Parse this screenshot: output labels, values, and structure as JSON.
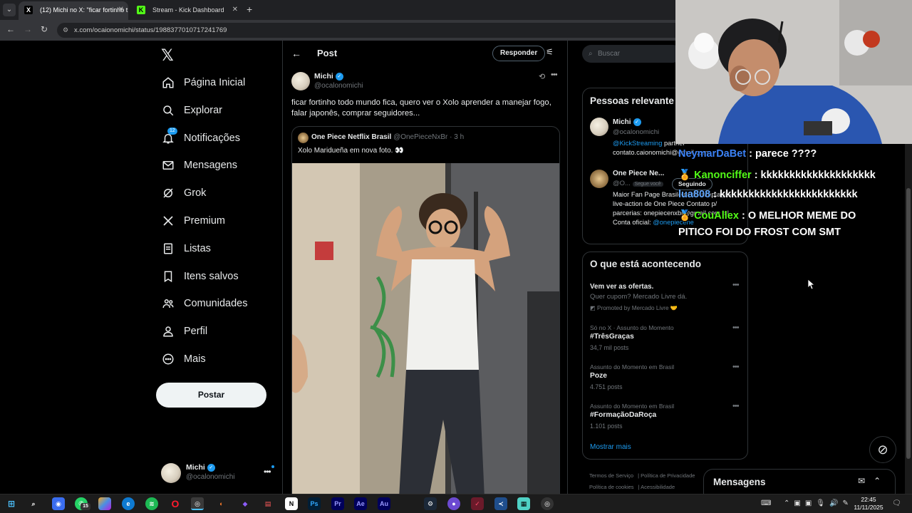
{
  "browser": {
    "tabs": [
      {
        "label": "(12) Michi no X: \"ficar fortinho t",
        "favicon": "X"
      },
      {
        "label": "Stream - Kick Dashboard",
        "favicon": "K"
      }
    ],
    "url": "x.com/ocaionomichi/status/1988377010717241769"
  },
  "sidebar": {
    "items": [
      {
        "label": "Página Inicial",
        "icon": "home-icon"
      },
      {
        "label": "Explorar",
        "icon": "search-icon"
      },
      {
        "label": "Notificações",
        "icon": "bell-icon",
        "badge": "12"
      },
      {
        "label": "Mensagens",
        "icon": "envelope-icon"
      },
      {
        "label": "Grok",
        "icon": "grok-icon"
      },
      {
        "label": "Premium",
        "icon": "x-logo-icon"
      },
      {
        "label": "Listas",
        "icon": "list-icon"
      },
      {
        "label": "Itens salvos",
        "icon": "bookmark-icon"
      },
      {
        "label": "Comunidades",
        "icon": "people-icon"
      },
      {
        "label": "Perfil",
        "icon": "person-icon"
      },
      {
        "label": "Mais",
        "icon": "more-circle-icon"
      }
    ],
    "post_button": "Postar",
    "account": {
      "name": "Michi",
      "handle": "@ocalonomichi"
    }
  },
  "post": {
    "header_title": "Post",
    "reply_button": "Responder",
    "author": {
      "name": "Michi",
      "handle": "@ocalonomichi"
    },
    "text": "ficar fortinho todo mundo fica, quero ver o Xolo aprender a manejar fogo, falar japonês, comprar seguidores...",
    "quote": {
      "name": "One Piece Netflix Brasil",
      "meta": "@OnePieceNxBr · 3 h",
      "text": "Xolo Maridueña em nova foto. 👀"
    }
  },
  "right": {
    "search_placeholder": "Buscar",
    "relevant": {
      "title": "Pessoas relevante",
      "people": [
        {
          "name": "Michi",
          "handle": "@ocalonomichi",
          "bio_link": "@KickStreaming",
          "bio_rest": " partner",
          "bio_line2": "contato.caionomichi@gmail.com"
        },
        {
          "name": "One Piece Ne...",
          "handle": "@O...",
          "follows_you": "Segue você",
          "follow_button": "Seguindo",
          "bio": "Maior Fan Page Brasileira da adaptação live-action de One Piece Contato p/ parcerias: onepiecenxbr@gmail.com |x| Conta oficial: ",
          "bio_link": "@onepiecene"
        }
      ]
    },
    "trends": {
      "title": "O que está acontecendo",
      "promo": {
        "title": "Vem ver as ofertas.",
        "subtitle": "Quer cupom? Mercado Livre dá.",
        "promoted": "Promoted by Mercado Livre 🤝"
      },
      "items": [
        {
          "context": "Só no X · Assunto do Momento",
          "name": "#TrêsGraças",
          "count": "34,7 mil posts"
        },
        {
          "context": "Assunto do Momento em Brasil",
          "name": "Poze",
          "count": "4.751 posts"
        },
        {
          "context": "Assunto do Momento em Brasil",
          "name": "#FormaçãoDaRoça",
          "count": "1.101 posts"
        }
      ],
      "show_more": "Mostrar mais"
    },
    "footer": [
      "Termos de Serviço",
      "Política de Privacidade",
      "Política de cookies",
      "Acessibilidade"
    ]
  },
  "overlay": {
    "chat": [
      {
        "user": "NeymarDaBet",
        "message": " : parece ????",
        "color": "#3b82f6"
      },
      {
        "user": "Kanonciffer",
        "message": " : kkkkkkkkkkkkkkkkkkkk",
        "color": "#53fc18"
      },
      {
        "user": "lua808",
        "message": " : kkkkkkkkkkkkkkkkkkkkkkkk",
        "color": "#60a5fa"
      },
      {
        "user": "CouAllex",
        "message": " : O MELHOR MEME DO",
        "color": "#53fc18"
      },
      {
        "user": "",
        "message": "PITICO FOI DO FROST COM SMT",
        "color": "#ffffff"
      }
    ],
    "messages_drawer": "Mensagens"
  },
  "taskbar": {
    "time": "22:45",
    "date": "11/11/2025",
    "badge_count": "15"
  },
  "colors": {
    "accent": "#1d9bf0",
    "kick_green": "#53fc18",
    "background": "#000000"
  }
}
